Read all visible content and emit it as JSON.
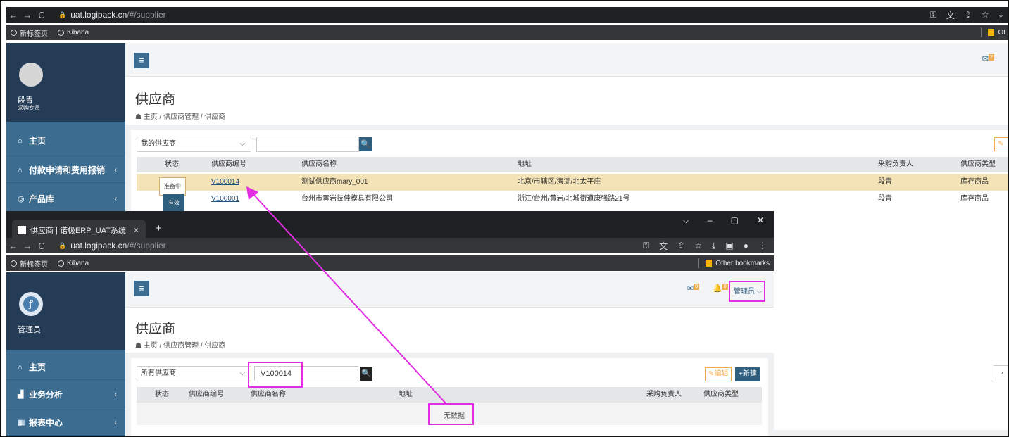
{
  "back": {
    "url_host": "uat.logipack.cn",
    "url_path": "/#/supplier",
    "bookmarks": [
      "新标签页",
      "Kibana"
    ],
    "other_bookmarks_label": "Ot",
    "user": {
      "name": "段青",
      "role": "采购专员"
    },
    "menu": [
      {
        "label": "主页",
        "icon": "home-icon"
      },
      {
        "label": "付款申请和费用报销",
        "icon": "bank-icon"
      },
      {
        "label": "产品库",
        "icon": "cube-icon"
      }
    ],
    "mail_count": "2",
    "page_title": "供应商",
    "breadcrumb": [
      "主页",
      "供应商管理",
      "供应商"
    ],
    "filter_select": "我的供应商",
    "search_value": "",
    "columns": [
      "状态",
      "供应商编号",
      "供应商名称",
      "地址",
      "采购负责人",
      "供应商类型"
    ],
    "rows": [
      {
        "status": "准备中",
        "code": "V100014",
        "name": "测试供应商mary_001",
        "address": "北京/市辖区/海淀/北太平庄",
        "buyer": "段青",
        "type": "库存商品"
      },
      {
        "status": "有效",
        "code": "V100001",
        "name": "台州市黄岩技佳模具有限公司",
        "address": "浙江/台州/黄岩/北城街道康强路21号",
        "buyer": "段青",
        "type": "库存商品"
      }
    ]
  },
  "front": {
    "tab_title": "供应商 | 诺极ERP_UAT系统",
    "url_host": "uat.logipack.cn",
    "url_path": "/#/supplier",
    "bookmarks": [
      "新标签页",
      "Kibana"
    ],
    "other_bookmarks_label": "Other bookmarks",
    "user": {
      "name": "管理员"
    },
    "menu": [
      {
        "label": "主页",
        "icon": "home-icon"
      },
      {
        "label": "业务分析",
        "icon": "bar-chart-icon"
      },
      {
        "label": "报表中心",
        "icon": "table-icon"
      }
    ],
    "mail_count": "0",
    "bell_count": "0",
    "admin_label": "管理员",
    "page_title": "供应商",
    "breadcrumb": [
      "主页",
      "供应商管理",
      "供应商"
    ],
    "filter_select": "所有供应商",
    "search_value": "V100014",
    "edit_label": "编辑",
    "new_label": "+新建",
    "columns": [
      "状态",
      "供应商编号",
      "供应商名称",
      "地址",
      "采购负责人",
      "供应商类型"
    ],
    "empty_text": "无数据"
  },
  "colors": {
    "sidebar": "#3c6d91",
    "profile": "#253c57",
    "highlight": "#e22de2",
    "selected_row": "#f3e3b7",
    "warning": "#f0ad4e"
  }
}
